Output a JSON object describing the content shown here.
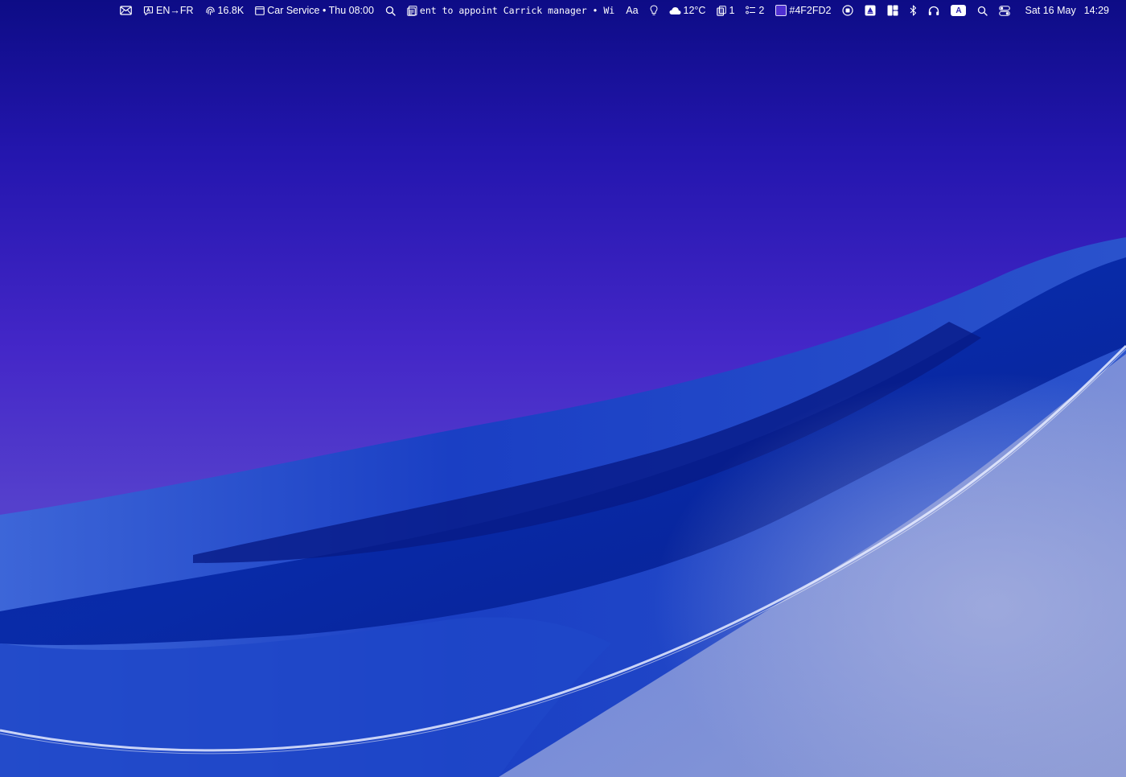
{
  "menubar": {
    "mail": {
      "icon": "envelope-icon"
    },
    "translate": {
      "icon": "translate-icon",
      "label": "EN→FR"
    },
    "stats": {
      "icon": "fingerprint-icon",
      "label": "16.8K"
    },
    "calendar": {
      "icon": "calendar-icon",
      "label": "Car Service • Thu 08:00"
    },
    "search_left": {
      "icon": "magnifier-icon"
    },
    "ticker": {
      "icon": "document-icon",
      "label": "ent to appoint Carrick manager • Wi"
    },
    "font": {
      "label": "Aa"
    },
    "idea": {
      "icon": "lightbulb-icon"
    },
    "weather": {
      "icon": "cloud-icon",
      "label": "12°C"
    },
    "clipboard": {
      "icon": "clipboard-icon",
      "label": "1"
    },
    "todo": {
      "icon": "checklist-icon",
      "label": "2"
    },
    "color_picker": {
      "icon": "color-swatch-icon",
      "label": "#4F2FD2",
      "swatch_color": "#4F2FD2"
    },
    "record": {
      "icon": "record-stop-icon"
    },
    "drive": {
      "icon": "drive-icon"
    },
    "layout": {
      "icon": "window-layout-icon"
    },
    "bluetooth": {
      "icon": "bluetooth-icon"
    },
    "headphones": {
      "icon": "headphones-icon"
    },
    "input_source": {
      "icon": "keyboard-a-icon",
      "label": "A"
    },
    "spotlight": {
      "icon": "spotlight-search-icon"
    },
    "control_center": {
      "icon": "control-center-icon"
    },
    "clock": {
      "date": "Sat 16 May",
      "time": "14:29"
    }
  },
  "colors": {
    "menubar_text": "#ffffff",
    "wallpaper_top": "#0f0e8a",
    "wallpaper_mid": "#4F2FD2",
    "wallpaper_wave": "#0a2aa8",
    "wallpaper_light": "#8a9ad8"
  }
}
